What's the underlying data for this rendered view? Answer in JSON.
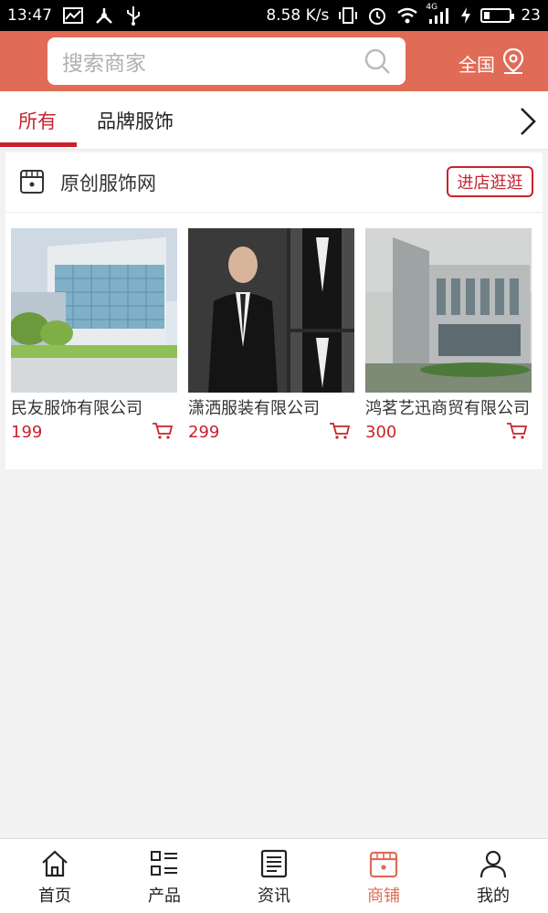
{
  "status_bar": {
    "time": "13:47",
    "speed": "8.58 K/s",
    "signal_label": "4G",
    "battery_level": "23",
    "icons": [
      "message-icon",
      "usb-share-icon",
      "usb-icon",
      "vibrate-icon",
      "alarm-icon",
      "wifi-icon",
      "signal-icon",
      "charging-icon",
      "battery-icon"
    ]
  },
  "header": {
    "search_placeholder": "搜索商家",
    "region_label": "全国",
    "accent_color": "#e06b56"
  },
  "tabs": [
    {
      "label": "所有",
      "active": true
    },
    {
      "label": "品牌服饰",
      "active": false
    }
  ],
  "shop": {
    "name": "原创服饰网",
    "visit_label": "进店逛逛",
    "products": [
      {
        "title": "民友服饰有限公司",
        "price": "199"
      },
      {
        "title": "潇洒服装有限公司",
        "price": "299"
      },
      {
        "title": "鸿茗艺迅商贸有限公司",
        "price": "300"
      }
    ]
  },
  "bottom_nav": [
    {
      "label": "首页",
      "icon": "home-icon",
      "active": false
    },
    {
      "label": "产品",
      "icon": "grid-list-icon",
      "active": false
    },
    {
      "label": "资讯",
      "icon": "news-icon",
      "active": false
    },
    {
      "label": "商铺",
      "icon": "store-icon",
      "active": true
    },
    {
      "label": "我的",
      "icon": "user-icon",
      "active": false
    }
  ]
}
